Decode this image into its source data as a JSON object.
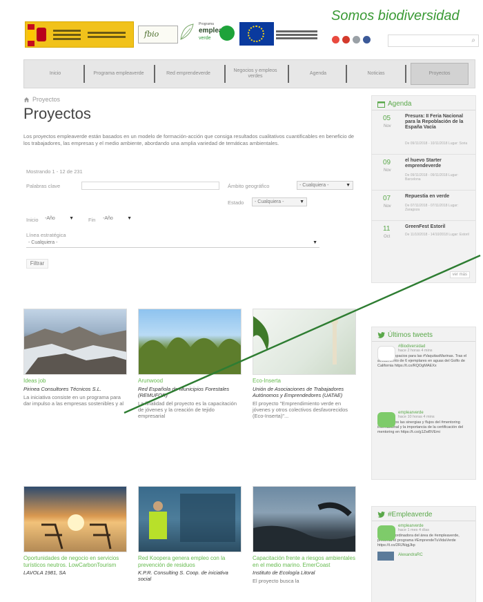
{
  "header": {
    "slogan": "Somos biodiversidad",
    "logos": {
      "biodiversidad": "fbio",
      "emplea_line1": "Programa",
      "emplea_line2": "emplea",
      "emplea_line3": "verde"
    },
    "social_colors": [
      "#e94a3f",
      "#d33a2c",
      "#3a9a35",
      "#3b5998"
    ],
    "search": {
      "placeholder": "",
      "icon": "search-icon"
    }
  },
  "nav": {
    "items": [
      {
        "label": "Inicio"
      },
      {
        "label": "Programa empleaverde"
      },
      {
        "label": "Red emprendeverde"
      },
      {
        "label": "Negocios y empleos verdes"
      },
      {
        "label": "Agenda"
      },
      {
        "label": "Noticias"
      },
      {
        "label": "Proyectos"
      }
    ],
    "active_index": 6
  },
  "breadcrumb": {
    "icon": "home-icon",
    "label": "Proyectos"
  },
  "page": {
    "title": "Proyectos",
    "intro": "Los proyectos empleaverde están basados en un modelo de formación-acción que consiga resultados cualitativos cuantificables en beneficio de los trabajadores, las empresas y el medio ambiente, abordando una amplia variedad de temáticas ambientales.",
    "showing": "Mostrando 1 - 12 de 231"
  },
  "filters": {
    "keywords_label": "Palabras clave",
    "geo_label": "Ámbito geográfico",
    "geo_value": "- Cualquiera -",
    "status_label": "Estado",
    "status_value": "- Cualquiera -",
    "start_label": "Inicio",
    "start_value": "-Año",
    "end_label": "Fin",
    "end_value": "-Año",
    "line_label": "Línea estratégica",
    "line_value": "- Cualquiera -",
    "button": "Filtrar"
  },
  "cards": [
    {
      "title": "Ideas job",
      "author": "Pirinea Consultores Técnicos S.L.",
      "desc": "La iniciativa consiste en un programa para dar impulso a las empresas sostenibles y al"
    },
    {
      "title": "Arunwood",
      "author": "Red Española de Municipios Forestales (REMUFOR)",
      "desc": "La finalidad del proyecto es la capacitación de jóvenes y la creación de tejido empresarial"
    },
    {
      "title": "Eco-Inserta",
      "author": "Unión de Asociaciones de Trabajadores Autónomos y Emprendedores (UATAE)",
      "desc": "El proyecto \"Emprendimiento verde en jóvenes y otros colectivos desfavorecidos (Eco-Inserta)\"..."
    },
    {
      "title": "Oportunidades de negocio en servicios turísticos neutros. LowCarbonTourism",
      "author": "LAVOLA 1981, SA",
      "desc": ""
    },
    {
      "title": "Red Koopera genera empleo con la prevención de residuos",
      "author": "K.P.R. Consulting S. Coop. de iniciativa social",
      "desc": ""
    },
    {
      "title": "Capacitación frente a riesgos ambientales en el medio marino. EmerCoast",
      "author": "Instituto de Ecología Litoral",
      "desc": "El proyecto busca la"
    }
  ],
  "agenda": {
    "title": "Agenda",
    "icon": "calendar-icon",
    "events": [
      {
        "day": "05",
        "month": "Nov",
        "title": "Presura: II Feria Nacional para la Repoblación de la España Vacía",
        "meta": "De 09/11/2018 - 10/11/2018 Lugar: Soria"
      },
      {
        "day": "09",
        "month": "Nov",
        "title": "el huevo Starter emprendeverde",
        "meta": "De 09/11/2018 - 09/11/2018 Lugar: Barcelona"
      },
      {
        "day": "07",
        "month": "Nov",
        "title": "Repuestia en verde",
        "meta": "De 07/11/2018 - 07/11/2018 Lugar: Zaragoza"
      },
      {
        "day": "11",
        "month": "Oct",
        "title": "GreenFest Estoril",
        "meta": "De 11/10/2018 - 14/10/2018 Lugar: Estoril"
      }
    ],
    "more": "ver más"
  },
  "tweets_panel": {
    "title": "Últimos tweets",
    "icon": "twitter-icon",
    "tweets": [
      {
        "handle": "#Biodiversidad",
        "time": "hace 2 horas 4 mins",
        "body": "Aún hay espacios para las #VaquitasMarinas. Tras el avistamiento de 6 ejemplares en aguas del Golfo de California https://t.co/RQOgMAEXx"
      },
      {
        "handle": "emplearverde",
        "time": "hace 10 horas 4 mins",
        "body": "Aprendemos las sinergias y flujos del #mentoring internacional y la importancia de la certificación del mentoring en https://t.co/g1ZwBVEmi"
      }
    ]
  },
  "hashtag_panel": {
    "title": "#Empleaverde",
    "icon": "twitter-icon",
    "tweets": [
      {
        "handle": "emplearverde",
        "time": "hace 1 mes 4 días",
        "body": "Valeria, coordinadora del área de #empleaverde, presenta el programa #EmprendeTuVidaVerde https://t.co/2RJNigjJkp"
      }
    ],
    "extra": "AlexandraRC"
  }
}
